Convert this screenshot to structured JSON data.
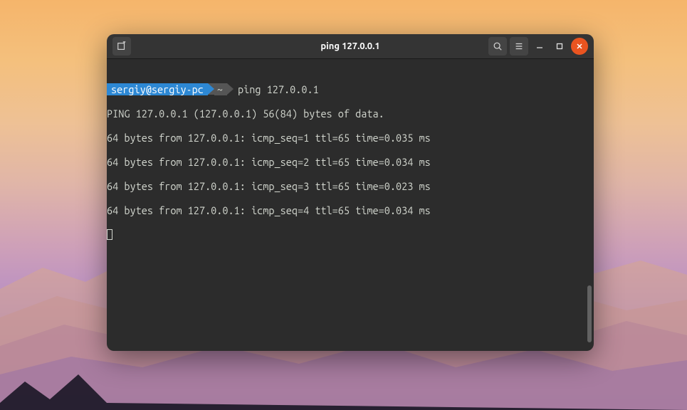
{
  "window": {
    "title": "ping 127.0.0.1"
  },
  "prompt": {
    "user_host": "sergiy@sergiy-pc",
    "path": "~",
    "command": "ping 127.0.0.1"
  },
  "output": [
    "PING 127.0.0.1 (127.0.0.1) 56(84) bytes of data.",
    "64 bytes from 127.0.0.1: icmp_seq=1 ttl=65 time=0.035 ms",
    "64 bytes from 127.0.0.1: icmp_seq=2 ttl=65 time=0.034 ms",
    "64 bytes from 127.0.0.1: icmp_seq=3 ttl=65 time=0.023 ms",
    "64 bytes from 127.0.0.1: icmp_seq=4 ttl=65 time=0.034 ms"
  ],
  "icons": {
    "newtab": "new-tab-icon",
    "search": "search-icon",
    "menu": "hamburger-menu-icon",
    "minimize": "minimize-icon",
    "maximize": "maximize-icon",
    "close": "close-icon"
  },
  "colors": {
    "titlebar": "#343434",
    "terminal_bg": "#2c2c2c",
    "prompt_blue": "#2d88d4",
    "prompt_grey": "#555555",
    "close_orange": "#e95420"
  }
}
